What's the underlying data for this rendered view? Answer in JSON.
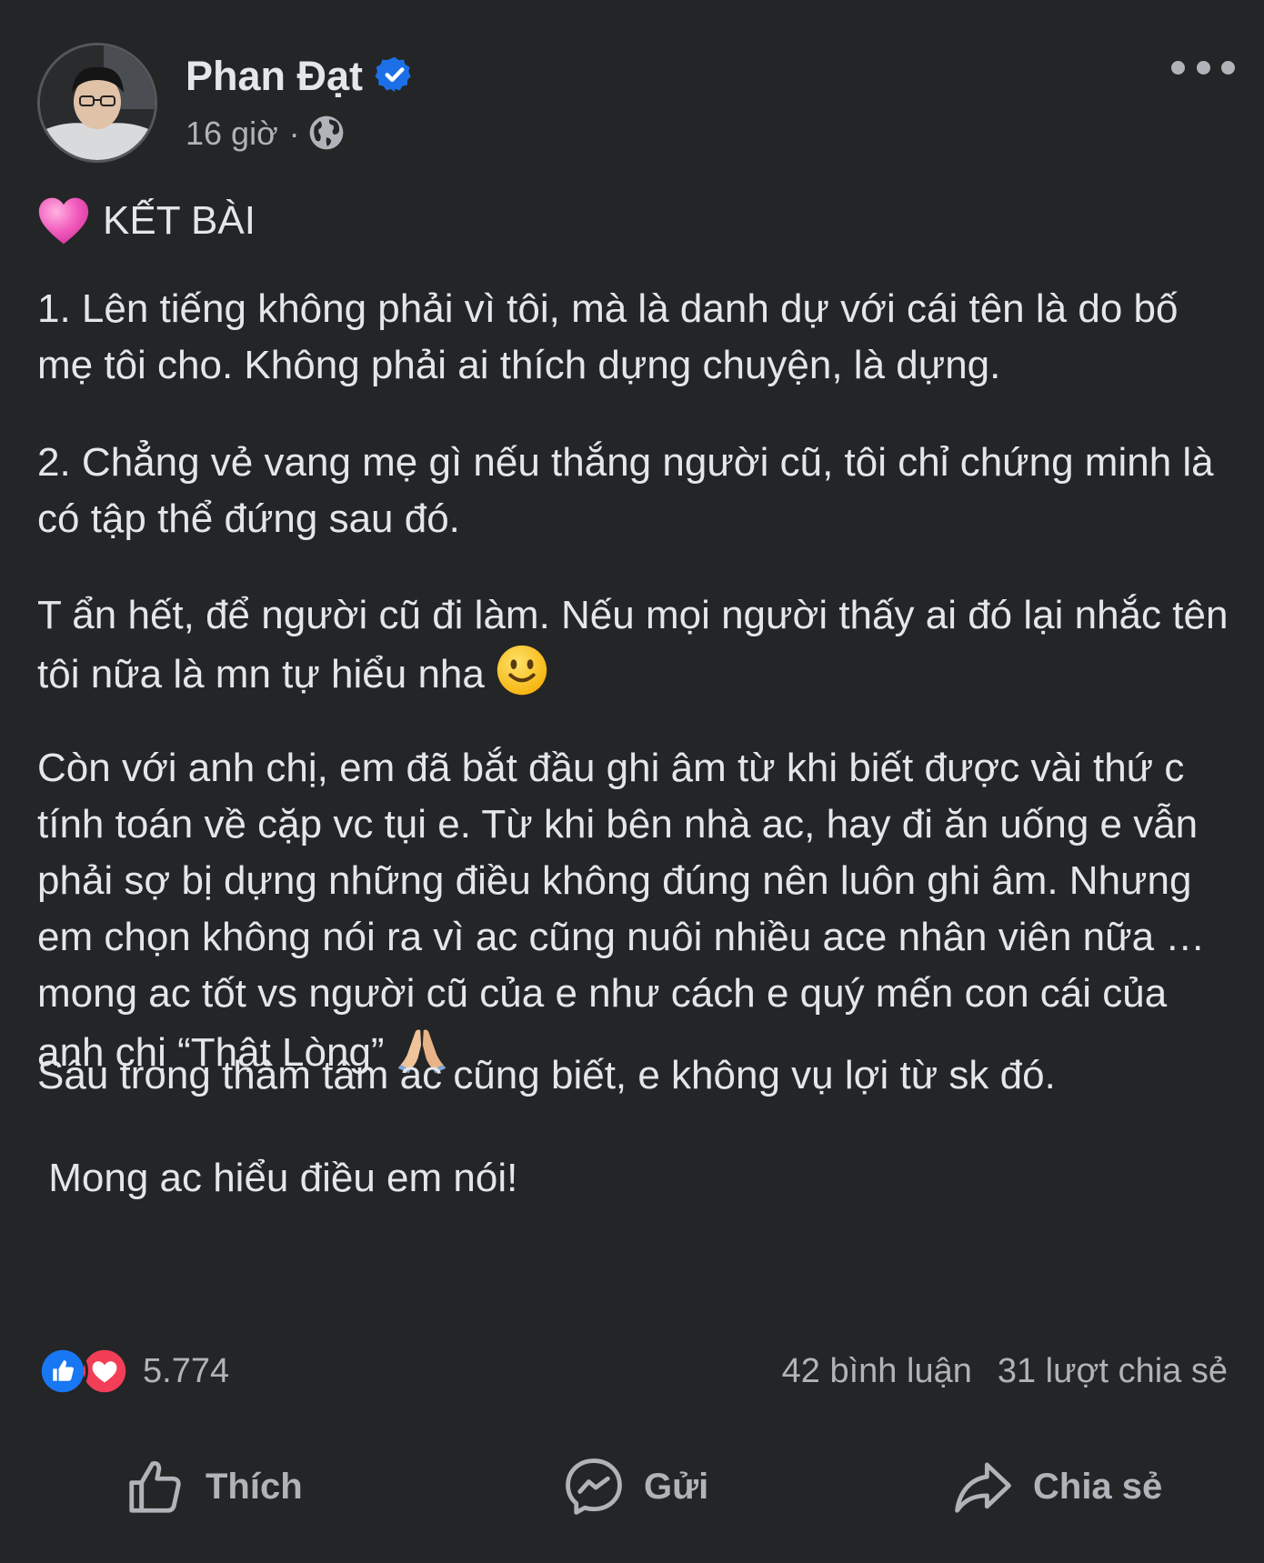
{
  "post": {
    "author": {
      "name": "Phan Đạt",
      "verified": true,
      "verified_icon": "verified-badge-icon"
    },
    "meta": {
      "time": "16 giờ",
      "separator": "·",
      "audience_icon": "globe-icon"
    },
    "heading": {
      "emoji": "pink-heart-emoji",
      "text": "KẾT BÀI"
    },
    "paragraphs": [
      "1. Lên tiếng không phải vì tôi, mà là danh dự với cái tên là do bố mẹ tôi cho. Không phải ai thích dựng chuyện, là dựng.",
      "2. Chẳng vẻ vang mẹ gì nếu thắng người cũ, tôi chỉ chứng minh là có tập thể đứng sau đó.",
      "T ẩn hết, để người cũ đi làm. Nếu mọi người thấy ai đó lại nhắc tên tôi nữa là mn tự hiểu nha",
      "Còn với anh chị, em đã bắt đầu ghi âm từ khi biết được vài thứ c tính toán về cặp vc tụi e. Từ khi bên nhà ac, hay đi ăn uống e vẫn phải sợ bị dựng những điều không đúng nên luôn ghi âm. Nhưng em chọn không nói ra vì ac cũng nuôi nhiều ace nhân viên nữa … mong ac tốt vs người cũ của e như cách e quý mến con cái của anh chị “Thật Lòng”",
      "Sâu trong thâm tâm ac cũng biết, e không vụ lợi từ sk đó.",
      " Mong ac hiểu điều em nói!"
    ],
    "inline_emojis": {
      "smile": "slightly-smiling-face-emoji",
      "pray": "folded-hands-emoji"
    }
  },
  "reactions": {
    "types": [
      "like",
      "love"
    ],
    "count": "5.774"
  },
  "stats": {
    "comments": "42 bình luận",
    "shares": "31 lượt chia sẻ"
  },
  "actions": {
    "like": "Thích",
    "send": "Gửi",
    "share": "Chia sẻ"
  },
  "colors": {
    "background": "#242526",
    "text": "#e4e6eb",
    "secondary": "#b0b3b8",
    "like_blue": "#1877f2",
    "love_red": "#f33e58",
    "verified_blue": "#1d6fe8"
  }
}
